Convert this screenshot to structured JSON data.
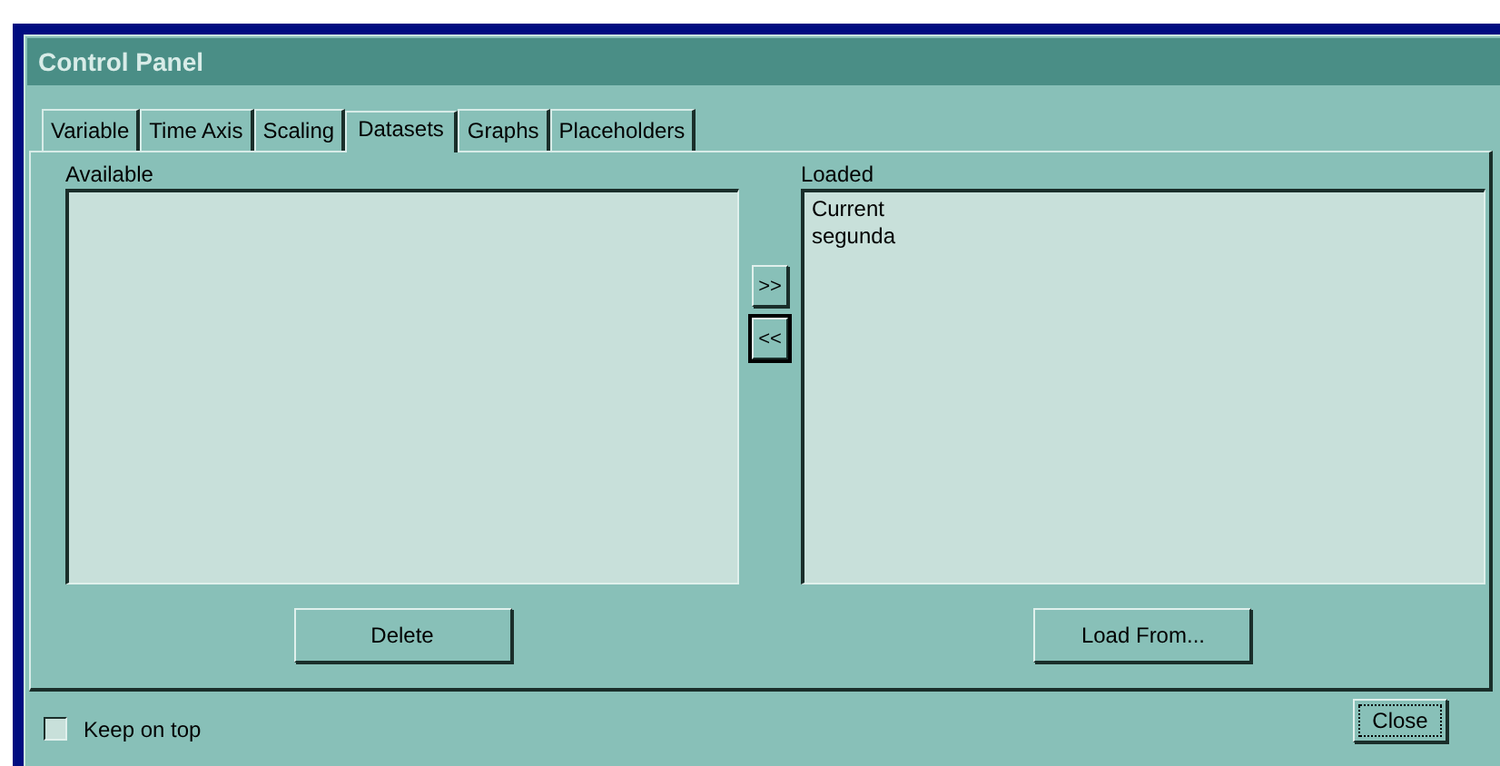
{
  "window": {
    "title": "Control Panel"
  },
  "tabs": [
    {
      "label": "Variable",
      "selected": false
    },
    {
      "label": "Time Axis",
      "selected": false
    },
    {
      "label": "Scaling",
      "selected": false
    },
    {
      "label": "Datasets",
      "selected": true
    },
    {
      "label": "Graphs",
      "selected": false
    },
    {
      "label": "Placeholders",
      "selected": false
    }
  ],
  "available": {
    "label": "Available",
    "button": "Delete"
  },
  "transfer_buttons": [
    {
      "label": ">>",
      "focused": false
    },
    {
      "label": "<<",
      "focused": true
    }
  ],
  "loaded": {
    "label": "Loaded",
    "items": [
      "Current",
      "segunda"
    ],
    "button": "Load From..."
  },
  "keep_on_top": {
    "label": "Keep on top",
    "checked": false
  },
  "close_button": "Close"
}
